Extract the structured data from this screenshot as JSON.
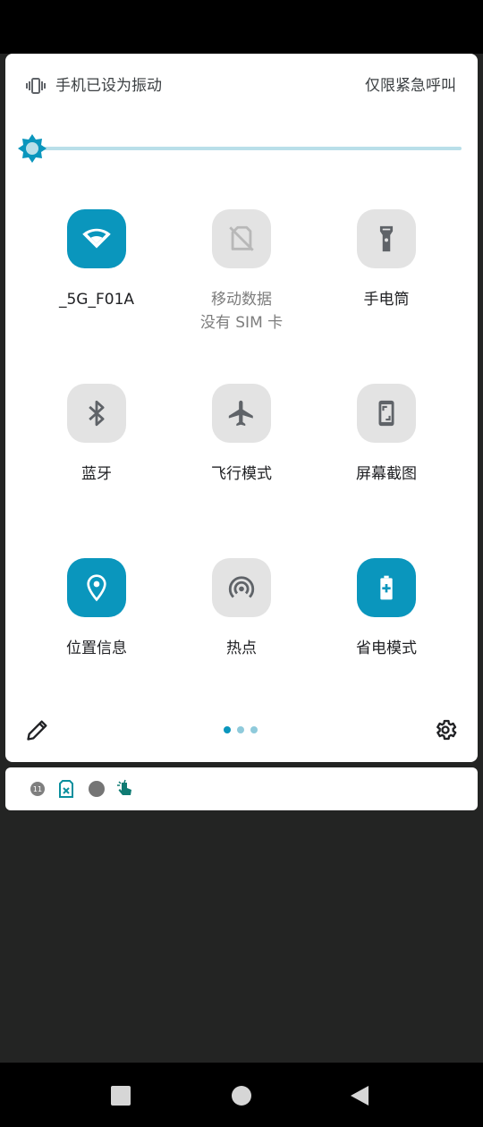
{
  "header": {
    "vibrate_text": "手机已设为振动",
    "carrier_text": "仅限紧急呼叫"
  },
  "brightness": {
    "level": 0.0
  },
  "tiles": [
    {
      "label": "_5G_F01A",
      "sub": "",
      "icon": "wifi-icon",
      "state": "on"
    },
    {
      "label": "移动数据",
      "sub": "没有 SIM 卡",
      "icon": "no-sim-icon",
      "state": "unavailable"
    },
    {
      "label": "手电筒",
      "sub": "",
      "icon": "flashlight-icon",
      "state": "off"
    },
    {
      "label": "蓝牙",
      "sub": "",
      "icon": "bluetooth-icon",
      "state": "off"
    },
    {
      "label": "飞行模式",
      "sub": "",
      "icon": "airplane-icon",
      "state": "off"
    },
    {
      "label": "屏幕截图",
      "sub": "",
      "icon": "screenshot-icon",
      "state": "off"
    },
    {
      "label": "位置信息",
      "sub": "",
      "icon": "location-icon",
      "state": "on"
    },
    {
      "label": "热点",
      "sub": "",
      "icon": "hotspot-icon",
      "state": "off"
    },
    {
      "label": "省电模式",
      "sub": "",
      "icon": "battery-saver-icon",
      "state": "on"
    }
  ],
  "footer": {
    "page_count": 3,
    "current_page": 1
  },
  "notification_icons": [
    "clock-badge-icon",
    "sim-error-icon",
    "dot-icon",
    "gesture-icon"
  ],
  "notification_badge": "11",
  "colors": {
    "accent": "#0a96bd",
    "tile_off": "#e3e3e3",
    "brightness_track": "#b9dfe9",
    "background": "#232423"
  }
}
